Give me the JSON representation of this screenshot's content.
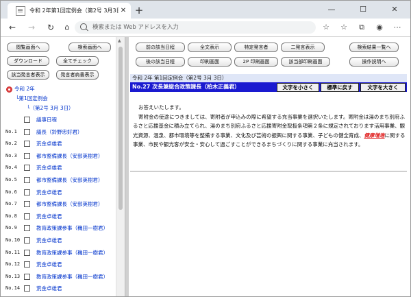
{
  "browser": {
    "tab_title": "令和 2年第1回定例会（第2号 3月3日）",
    "new_tab": "+",
    "omnibox_placeholder": "検索または Web アドレスを入力",
    "controls": {
      "minimize": "—",
      "maximize": "☐",
      "close": "✕"
    }
  },
  "left_panel": {
    "buttons": {
      "list_screen": "閲覧画面へ",
      "search_screen": "検索画面へ",
      "download": "ダウンロード",
      "check_all": "全てチェック",
      "show_speakers": "該当発言者表示",
      "speaker_clerk": "発言者肩書表示"
    },
    "tree": {
      "year": "令和 2年",
      "session": "第1回定例会",
      "issue": "（第2号 3月 3日）"
    },
    "items": [
      {
        "no": "",
        "label": "議事日程"
      },
      {
        "no": "No.1",
        "label": "議長（鈴野忠好君）"
      },
      {
        "no": "No.2",
        "label": "荒金卓雄君"
      },
      {
        "no": "No.3",
        "label": "都市整備課長（安部英樹君）"
      },
      {
        "no": "No.4",
        "label": "荒金卓雄君"
      },
      {
        "no": "No.5",
        "label": "都市整備課長（安部英樹君）"
      },
      {
        "no": "No.6",
        "label": "荒金卓雄君"
      },
      {
        "no": "No.7",
        "label": "都市整備課長（安部英樹君）"
      },
      {
        "no": "No.8",
        "label": "荒金卓雄君"
      },
      {
        "no": "No.9",
        "label": "教育政策課参事（穐田一樹君）"
      },
      {
        "no": "No.10",
        "label": "荒金卓雄君"
      },
      {
        "no": "No.11",
        "label": "教育政策課参事（穐田一樹君）"
      },
      {
        "no": "No.12",
        "label": "荒金卓雄君"
      },
      {
        "no": "No.13",
        "label": "教育政策課参事（穐田一樹君）"
      },
      {
        "no": "No.14",
        "label": "荒金卓雄君"
      }
    ]
  },
  "right_panel": {
    "buttons": {
      "prev_day": "前の該当日程",
      "show_all": "全文表示",
      "specific_speaker": "特定発言者",
      "dual_display": "二発言表示",
      "to_search_results": "検索結果一覧へ",
      "next_day": "後の該当日程",
      "print_screen": "印刷画面",
      "print_2p": "2P 印刷画面",
      "print_matching": "該当部印刷画面",
      "how_to": "操作説明へ"
    },
    "meeting_header": "令和 2年 第1回定例会（第2号 3月 3日）",
    "speaker_header": "No.27 次長兼総合政策課長（柏木正義君）",
    "size_buttons": {
      "smaller": "文字を小さく",
      "reset": "標準に戻す",
      "larger": "文字を大きく"
    },
    "body": {
      "line1": "お答えいたします。",
      "para_before": "寄附金の使途につきましては、寄附者が申込みの際に希望する充当事業を選択いたします。寄附金は湯のまち別府ふるさと応援基金に積み立てられ、湯のまち別府ふるさと応援寄附金取扱条項第２条に規定されております活用事業、観光資源、温泉、都市環境等を整備する事業、文化及び芸術の振興に関する事業、子どもの健全育成、",
      "highlight": "健康増進",
      "para_after": "に関する事業、市民や観光客が安全・安心して過ごすことができるまちづくりに関する事業に充当されます。"
    }
  }
}
